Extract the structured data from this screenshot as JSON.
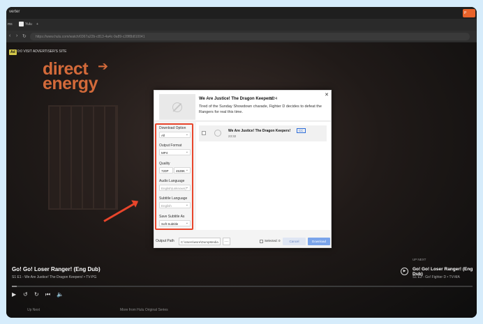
{
  "app": {
    "title": "verter",
    "action_label": "P"
  },
  "browser": {
    "tabs": [
      "ms",
      "Yulu",
      "+"
    ],
    "url": "https://www.hulu.com/watch/0367a22b-c813-4a4c-9a89-c28f8b810041"
  },
  "video": {
    "ad_badge": "Ad",
    "ad_text": "0:0   VISIT ADVERTISER'S SITE",
    "brand_line1": "direct",
    "brand_line2": "energy",
    "title": "Go! Go! Loser Ranger! (Eng Dub)",
    "subtitle": "S1 E1 - We Are Justice! The Dragon Keepers! • TV-PG",
    "up_next_label": "UP NEXT",
    "up_next_title": "Go! Go! Loser Ranger! (Eng Dub)",
    "up_next_sub": "S1 E2 - Go! Fighter D • TV-MA",
    "progress": 0.01,
    "bottom_left_label": "Up Next",
    "bottom_mid_label": "More from Hulu Original Series"
  },
  "dialog": {
    "episode_title": "We Are Justice! The Dragon Keepers!",
    "episode_year": "2024",
    "episode_desc": "Tired of the Sunday Showdown charade, Fighter D decides to defeat the Rangers for real this time.",
    "options": {
      "download_option": {
        "label": "Download Option",
        "value": "All"
      },
      "output_format": {
        "label": "Output Format",
        "value": "MP4"
      },
      "quality": {
        "label": "Quality",
        "value1": "720P",
        "value2": "4539K"
      },
      "audio_language": {
        "label": "Audio Language",
        "value": "English(unknown)"
      },
      "subtitle_language": {
        "label": "Subtitle Language",
        "value": "English"
      },
      "save_subtitle_as": {
        "label": "Save Subtitle As",
        "value": "Soft Subtitle"
      }
    },
    "item": {
      "title": "We Are Justice! The Dragon Keepers!",
      "badge": "CC",
      "duration": "23:32"
    },
    "footer": {
      "output_label": "Output Path",
      "output_path": "C:\\Users\\wsre\\DumpMedia",
      "selected_label": "Selected: 0",
      "cancel_label": "Cancel",
      "download_label": "Download"
    }
  }
}
